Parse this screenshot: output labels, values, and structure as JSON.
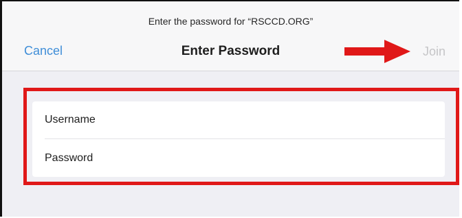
{
  "dialog": {
    "prompt": "Enter the password for “RSCCD.ORG”",
    "title": "Enter Password",
    "cancel_label": "Cancel",
    "join_label": "Join"
  },
  "form": {
    "fields": [
      {
        "placeholder": "Username"
      },
      {
        "placeholder": "Password"
      }
    ]
  },
  "colors": {
    "accent": "#3f8ed8",
    "disabled": "#c5c5c7",
    "annotation": "#e01818",
    "background": "#efeff4"
  },
  "icons": {
    "annotation_arrow": "right-arrow-icon"
  }
}
